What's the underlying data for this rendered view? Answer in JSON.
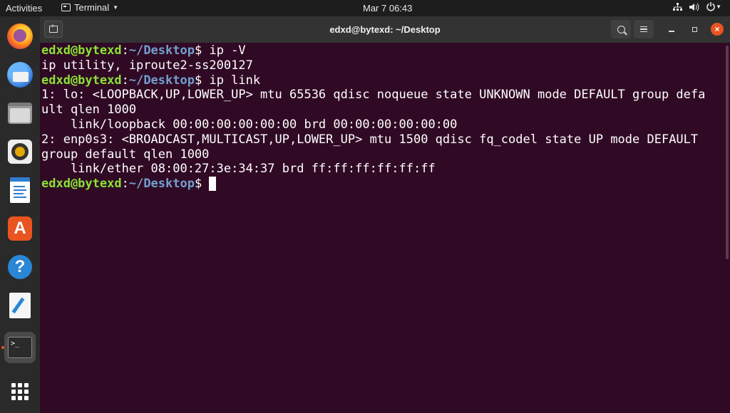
{
  "topbar": {
    "activities": "Activities",
    "app_menu": "Terminal",
    "clock": "Mar 7  06:43",
    "tray_icons": [
      "network-icon",
      "volume-icon",
      "power-icon"
    ]
  },
  "dock": {
    "items": [
      {
        "name": "Firefox",
        "icon": "firefox-icon"
      },
      {
        "name": "Thunderbird",
        "icon": "thunderbird-icon"
      },
      {
        "name": "Files",
        "icon": "files-icon"
      },
      {
        "name": "Rhythmbox",
        "icon": "rhythmbox-icon"
      },
      {
        "name": "LibreOffice Writer",
        "icon": "writer-icon"
      },
      {
        "name": "Ubuntu Software",
        "icon": "software-icon"
      },
      {
        "name": "Help",
        "icon": "help-icon"
      },
      {
        "name": "Text Editor",
        "icon": "text-editor-icon"
      },
      {
        "name": "Terminal",
        "icon": "terminal-icon",
        "active": true
      },
      {
        "name": "Show Applications",
        "icon": "app-grid-icon"
      }
    ],
    "store_glyph": "A",
    "help_glyph": "?",
    "terminal_glyph": ">_"
  },
  "window": {
    "title": "edxd@bytexd: ~/Desktop",
    "close_glyph": "×"
  },
  "terminal": {
    "user_host": "edxd@bytexd",
    "colon": ":",
    "path": "~/Desktop",
    "prompt_symbol": "$ ",
    "lines": [
      {
        "type": "prompt",
        "command": "ip -V"
      },
      {
        "type": "output",
        "text": "ip utility, iproute2-ss200127"
      },
      {
        "type": "prompt",
        "command": "ip link"
      },
      {
        "type": "output",
        "text": "1: lo: <LOOPBACK,UP,LOWER_UP> mtu 65536 qdisc noqueue state UNKNOWN mode DEFAULT group defa"
      },
      {
        "type": "output",
        "text": "ult qlen 1000"
      },
      {
        "type": "output",
        "text": "    link/loopback 00:00:00:00:00:00 brd 00:00:00:00:00:00"
      },
      {
        "type": "output",
        "text": "2: enp0s3: <BROADCAST,MULTICAST,UP,LOWER_UP> mtu 1500 qdisc fq_codel state UP mode DEFAULT"
      },
      {
        "type": "output",
        "text": "group default qlen 1000"
      },
      {
        "type": "output",
        "text": "    link/ether 08:00:27:3e:34:37 brd ff:ff:ff:ff:ff:ff"
      },
      {
        "type": "prompt",
        "command": ""
      }
    ]
  },
  "colors": {
    "terminal_bg": "#300a24",
    "user_host": "#8ae234",
    "path": "#729fcf",
    "accent": "#e95420"
  }
}
